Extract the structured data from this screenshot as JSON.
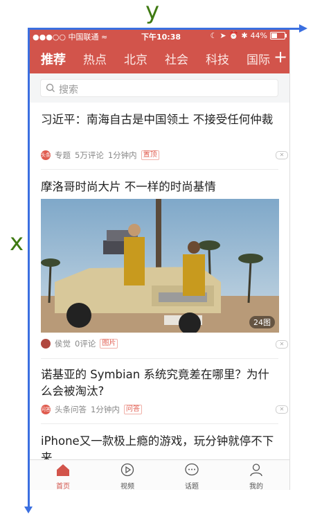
{
  "annotations": {
    "x_label": "x",
    "y_label": "y"
  },
  "status_bar": {
    "carrier": "●●●○○ 中国联通",
    "time": "下午10:38",
    "battery": "44%"
  },
  "nav": {
    "tabs": [
      "推荐",
      "热点",
      "北京",
      "社会",
      "科技",
      "国际"
    ],
    "plus": "+"
  },
  "search": {
    "placeholder": "搜索"
  },
  "articles": [
    {
      "title": "习近平：南海自古是中国领土 不接受任何仲裁",
      "source_icon": "头条",
      "source": "专题",
      "comments": "5万评论",
      "time": "1分钟内",
      "tag": "置顶"
    },
    {
      "title": "摩洛哥时尚大片 不一样的时尚基情",
      "image_count": "24图",
      "source": "侯觉",
      "comments": "0评论",
      "tag": "图片"
    },
    {
      "title": "诺基亚的 Symbian 系统究竟差在哪里？为什么会被淘汰?",
      "source_icon": "问答",
      "source": "头条问答",
      "time": "1分钟内",
      "tag": "问答"
    },
    {
      "title": "iPhone又一款极上瘾的游戏，玩分钟就停不下来"
    }
  ],
  "tab_bar": {
    "items": [
      "首页",
      "视频",
      "话题",
      "我的"
    ],
    "active": "首页"
  },
  "colors": {
    "brand": "#d2544b",
    "annotation_axis": "#3b6fe0",
    "annotation_label": "#3f7a12"
  }
}
